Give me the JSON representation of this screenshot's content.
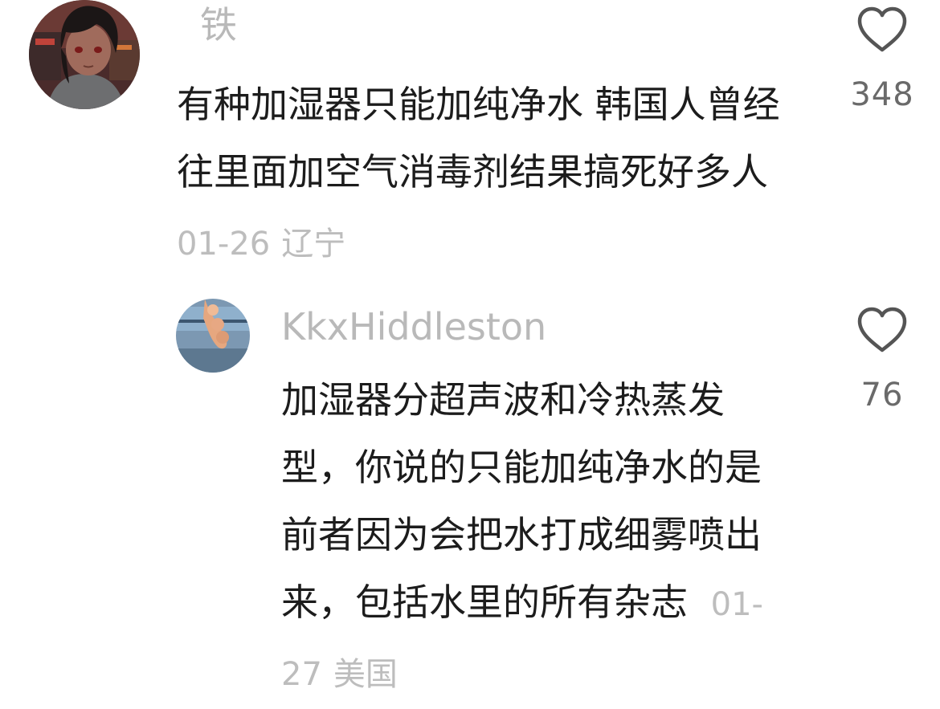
{
  "comments": [
    {
      "username": "铁",
      "text": "有种加湿器只能加纯净水 韩国人曾经往里面加空气消毒剂结果搞死好多人",
      "date": "01-26",
      "location": "辽宁",
      "likes": "348",
      "avatar_icon": "anime-character-avatar",
      "like_icon": "heart-outline-icon"
    },
    {
      "username": "KkxHiddleston",
      "text": "加湿器分超声波和冷热蒸发型，你说的只能加纯净水的是前者因为会把水打成细雾喷出来，包括水里的所有杂志",
      "date": "01-27",
      "location": "美国",
      "likes": "76",
      "avatar_icon": "photo-avatar",
      "like_icon": "heart-outline-icon"
    }
  ]
}
